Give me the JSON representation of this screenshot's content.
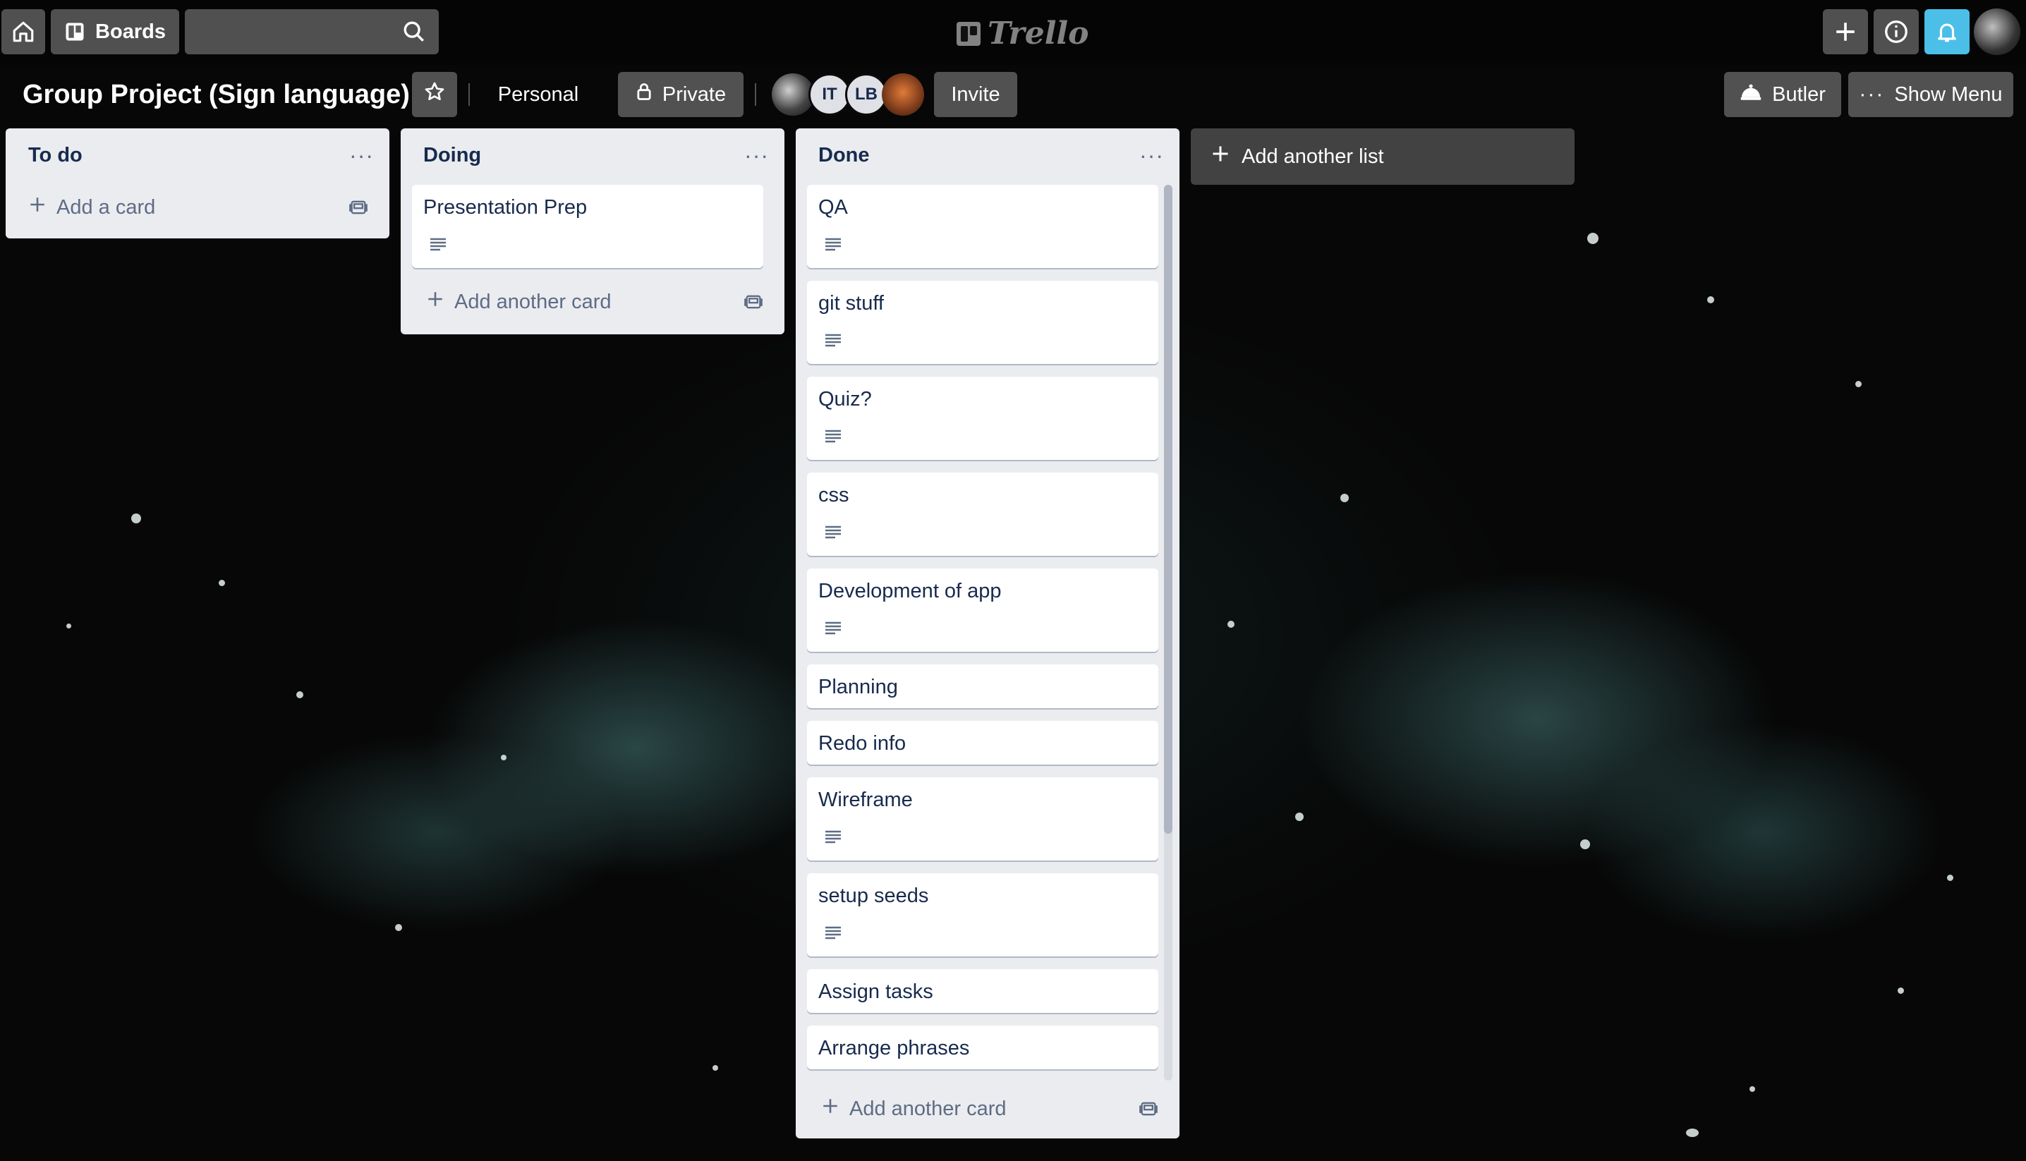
{
  "header": {
    "boards_label": "Boards",
    "search": {
      "value": "",
      "placeholder": ""
    },
    "logo_text": "Trello"
  },
  "board": {
    "title": "Group Project (Sign language)",
    "team_label": "Personal",
    "visibility_label": "Private",
    "members": [
      {
        "initials": "",
        "type": "photo"
      },
      {
        "initials": "IT",
        "type": "initials"
      },
      {
        "initials": "LB",
        "type": "initials"
      },
      {
        "initials": "",
        "type": "photo"
      }
    ],
    "invite_label": "Invite",
    "butler_label": "Butler",
    "menu_label": "Show Menu"
  },
  "lists": [
    {
      "title": "To do",
      "cards": [],
      "add_label": "Add a card"
    },
    {
      "title": "Doing",
      "cards": [
        {
          "title": "Presentation Prep",
          "has_description": true
        }
      ],
      "add_label": "Add another card"
    },
    {
      "title": "Done",
      "cards": [
        {
          "title": "QA",
          "has_description": true
        },
        {
          "title": "git stuff",
          "has_description": true
        },
        {
          "title": "Quiz?",
          "has_description": true
        },
        {
          "title": "css",
          "has_description": true
        },
        {
          "title": "Development of app",
          "has_description": true
        },
        {
          "title": "Planning",
          "has_description": false
        },
        {
          "title": "Redo info",
          "has_description": false
        },
        {
          "title": "Wireframe",
          "has_description": true
        },
        {
          "title": "setup seeds",
          "has_description": true
        },
        {
          "title": "Assign tasks",
          "has_description": false
        },
        {
          "title": "Arrange phrases",
          "has_description": false
        }
      ],
      "add_label": "Add another card"
    }
  ],
  "add_list_label": "Add another list",
  "colors": {
    "notification_button": "#4bbfe8",
    "list_bg": "#ebecf0",
    "card_text": "#172b4d",
    "muted_text": "#5e6c84"
  },
  "icons": [
    "home-icon",
    "boards-icon",
    "search-icon",
    "plus-icon",
    "info-icon",
    "bell-icon",
    "star-icon",
    "lock-icon",
    "butler-icon",
    "more-icon",
    "template-icon",
    "description-icon"
  ]
}
